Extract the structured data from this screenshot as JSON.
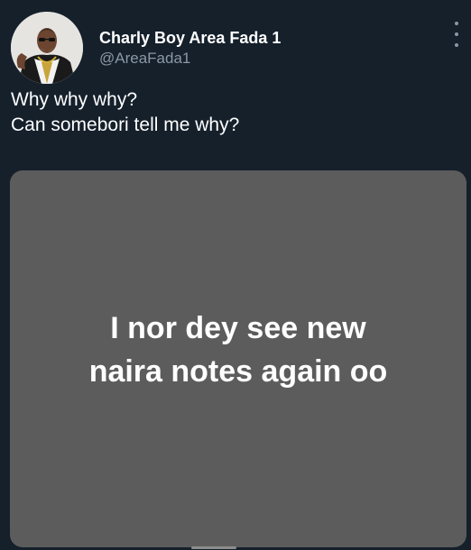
{
  "author": {
    "display_name": "Charly Boy Area Fada 1",
    "handle": "@AreaFada1",
    "avatar_icon": "profile-photo"
  },
  "menu": {
    "icon": "more-vertical-icon"
  },
  "tweet": {
    "lines": [
      "Why why why?",
      "Can somebori tell me why?"
    ]
  },
  "media": {
    "lines": [
      "I nor dey see new",
      "naira notes again oo"
    ],
    "background": "#5c5c5c"
  },
  "colors": {
    "background": "#15202b",
    "secondary_text": "#8b98a5"
  }
}
